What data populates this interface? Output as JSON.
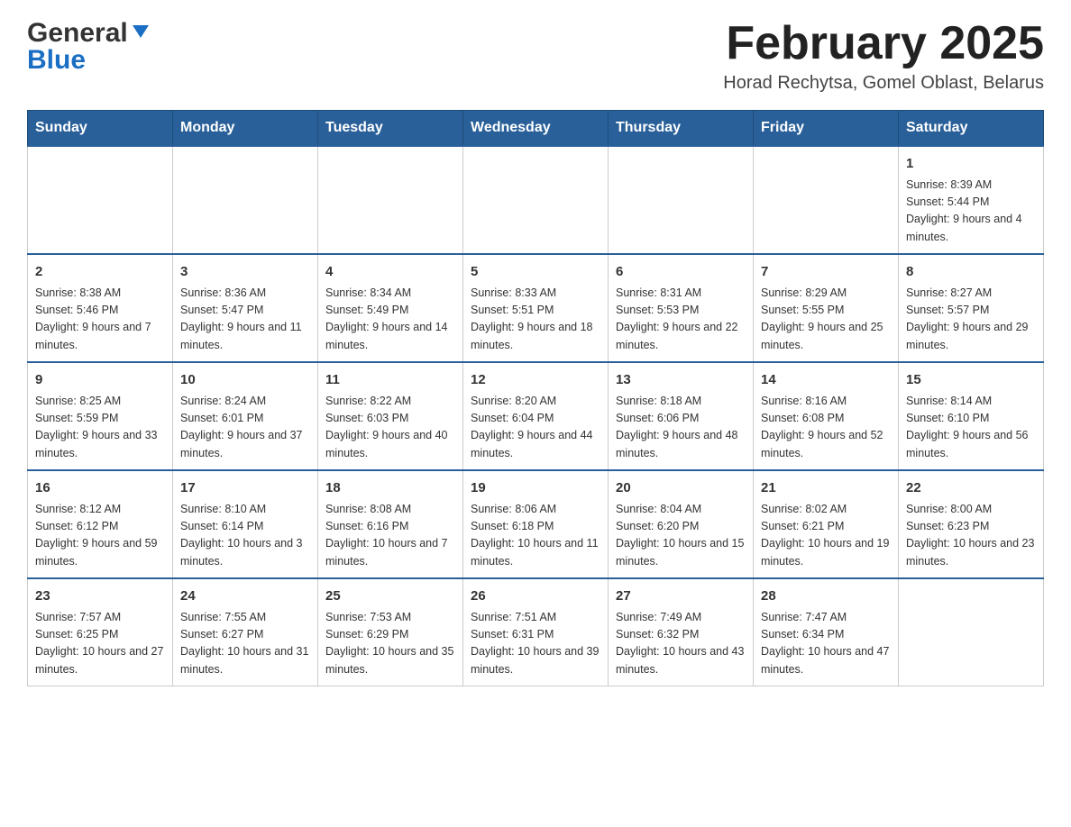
{
  "header": {
    "logo": {
      "line1": "General",
      "line2": "Blue"
    },
    "title": "February 2025",
    "location": "Horad Rechytsa, Gomel Oblast, Belarus"
  },
  "days_of_week": [
    "Sunday",
    "Monday",
    "Tuesday",
    "Wednesday",
    "Thursday",
    "Friday",
    "Saturday"
  ],
  "weeks": [
    {
      "days": [
        {
          "date": "",
          "info": ""
        },
        {
          "date": "",
          "info": ""
        },
        {
          "date": "",
          "info": ""
        },
        {
          "date": "",
          "info": ""
        },
        {
          "date": "",
          "info": ""
        },
        {
          "date": "",
          "info": ""
        },
        {
          "date": "1",
          "info": "Sunrise: 8:39 AM\nSunset: 5:44 PM\nDaylight: 9 hours and 4 minutes."
        }
      ]
    },
    {
      "days": [
        {
          "date": "2",
          "info": "Sunrise: 8:38 AM\nSunset: 5:46 PM\nDaylight: 9 hours and 7 minutes."
        },
        {
          "date": "3",
          "info": "Sunrise: 8:36 AM\nSunset: 5:47 PM\nDaylight: 9 hours and 11 minutes."
        },
        {
          "date": "4",
          "info": "Sunrise: 8:34 AM\nSunset: 5:49 PM\nDaylight: 9 hours and 14 minutes."
        },
        {
          "date": "5",
          "info": "Sunrise: 8:33 AM\nSunset: 5:51 PM\nDaylight: 9 hours and 18 minutes."
        },
        {
          "date": "6",
          "info": "Sunrise: 8:31 AM\nSunset: 5:53 PM\nDaylight: 9 hours and 22 minutes."
        },
        {
          "date": "7",
          "info": "Sunrise: 8:29 AM\nSunset: 5:55 PM\nDaylight: 9 hours and 25 minutes."
        },
        {
          "date": "8",
          "info": "Sunrise: 8:27 AM\nSunset: 5:57 PM\nDaylight: 9 hours and 29 minutes."
        }
      ]
    },
    {
      "days": [
        {
          "date": "9",
          "info": "Sunrise: 8:25 AM\nSunset: 5:59 PM\nDaylight: 9 hours and 33 minutes."
        },
        {
          "date": "10",
          "info": "Sunrise: 8:24 AM\nSunset: 6:01 PM\nDaylight: 9 hours and 37 minutes."
        },
        {
          "date": "11",
          "info": "Sunrise: 8:22 AM\nSunset: 6:03 PM\nDaylight: 9 hours and 40 minutes."
        },
        {
          "date": "12",
          "info": "Sunrise: 8:20 AM\nSunset: 6:04 PM\nDaylight: 9 hours and 44 minutes."
        },
        {
          "date": "13",
          "info": "Sunrise: 8:18 AM\nSunset: 6:06 PM\nDaylight: 9 hours and 48 minutes."
        },
        {
          "date": "14",
          "info": "Sunrise: 8:16 AM\nSunset: 6:08 PM\nDaylight: 9 hours and 52 minutes."
        },
        {
          "date": "15",
          "info": "Sunrise: 8:14 AM\nSunset: 6:10 PM\nDaylight: 9 hours and 56 minutes."
        }
      ]
    },
    {
      "days": [
        {
          "date": "16",
          "info": "Sunrise: 8:12 AM\nSunset: 6:12 PM\nDaylight: 9 hours and 59 minutes."
        },
        {
          "date": "17",
          "info": "Sunrise: 8:10 AM\nSunset: 6:14 PM\nDaylight: 10 hours and 3 minutes."
        },
        {
          "date": "18",
          "info": "Sunrise: 8:08 AM\nSunset: 6:16 PM\nDaylight: 10 hours and 7 minutes."
        },
        {
          "date": "19",
          "info": "Sunrise: 8:06 AM\nSunset: 6:18 PM\nDaylight: 10 hours and 11 minutes."
        },
        {
          "date": "20",
          "info": "Sunrise: 8:04 AM\nSunset: 6:20 PM\nDaylight: 10 hours and 15 minutes."
        },
        {
          "date": "21",
          "info": "Sunrise: 8:02 AM\nSunset: 6:21 PM\nDaylight: 10 hours and 19 minutes."
        },
        {
          "date": "22",
          "info": "Sunrise: 8:00 AM\nSunset: 6:23 PM\nDaylight: 10 hours and 23 minutes."
        }
      ]
    },
    {
      "days": [
        {
          "date": "23",
          "info": "Sunrise: 7:57 AM\nSunset: 6:25 PM\nDaylight: 10 hours and 27 minutes."
        },
        {
          "date": "24",
          "info": "Sunrise: 7:55 AM\nSunset: 6:27 PM\nDaylight: 10 hours and 31 minutes."
        },
        {
          "date": "25",
          "info": "Sunrise: 7:53 AM\nSunset: 6:29 PM\nDaylight: 10 hours and 35 minutes."
        },
        {
          "date": "26",
          "info": "Sunrise: 7:51 AM\nSunset: 6:31 PM\nDaylight: 10 hours and 39 minutes."
        },
        {
          "date": "27",
          "info": "Sunrise: 7:49 AM\nSunset: 6:32 PM\nDaylight: 10 hours and 43 minutes."
        },
        {
          "date": "28",
          "info": "Sunrise: 7:47 AM\nSunset: 6:34 PM\nDaylight: 10 hours and 47 minutes."
        },
        {
          "date": "",
          "info": ""
        }
      ]
    }
  ]
}
